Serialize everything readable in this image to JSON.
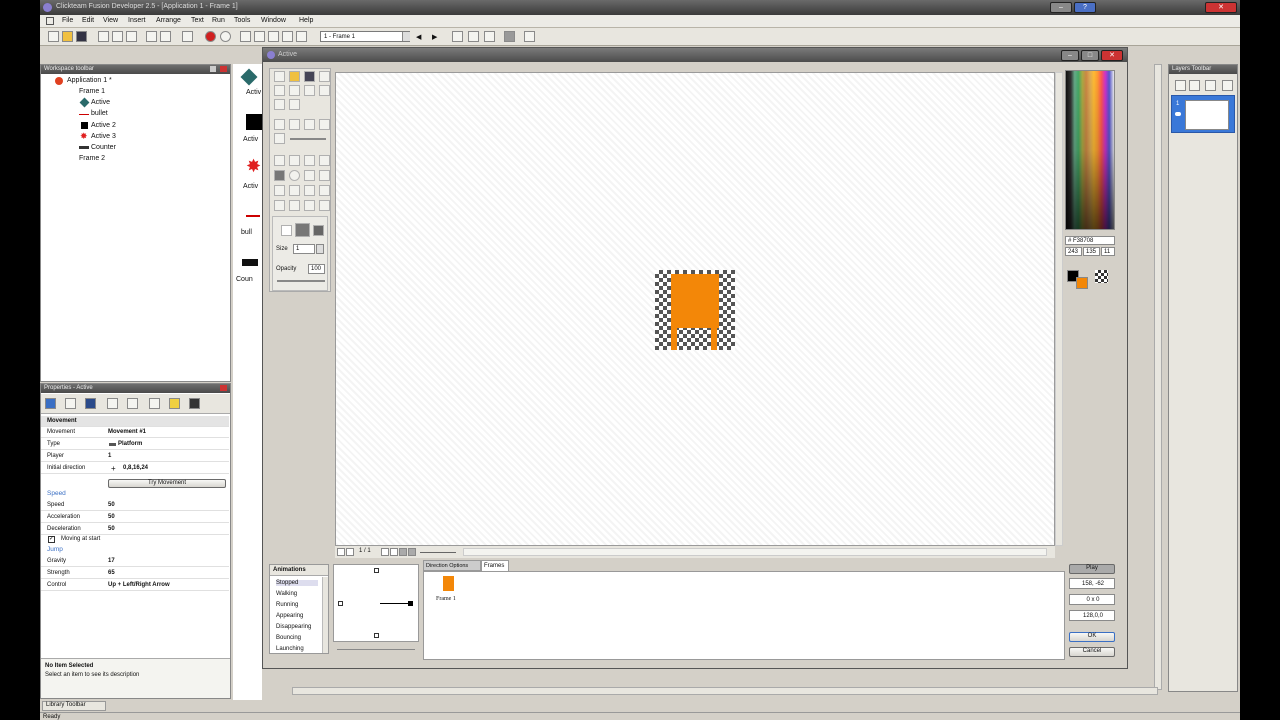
{
  "window": {
    "title": "Clickteam Fusion Developer 2.5 - [Application 1 - Frame 1]"
  },
  "menu": [
    "File",
    "Edit",
    "View",
    "Insert",
    "Arrange",
    "Text",
    "Run",
    "Tools",
    "Window",
    "Help"
  ],
  "toolbar": {
    "frame_select": "1 - Frame 1"
  },
  "workspace": {
    "title": "Workspace toolbar",
    "items": [
      "Application 1 *",
      "Frame 1",
      "Active",
      "bullet",
      "Active 2",
      "Active 3",
      "Counter",
      "Frame 2"
    ]
  },
  "frame_objects": [
    "Activ",
    "Activ",
    "Activ",
    "bull",
    "Coun"
  ],
  "properties": {
    "title": "Properties - Active",
    "header": "Movement",
    "rows": [
      {
        "k": "Movement",
        "v": "Movement #1"
      },
      {
        "k": "Type",
        "v": "Platform"
      },
      {
        "k": "Player",
        "v": "1"
      },
      {
        "k": "Initial direction",
        "v": "0,8,16,24"
      }
    ],
    "try_button": "Try Movement",
    "speed_section": "Speed",
    "speed_rows": [
      {
        "k": "Speed",
        "v": "50"
      },
      {
        "k": "Acceleration",
        "v": "50"
      },
      {
        "k": "Deceleration",
        "v": "50"
      }
    ],
    "moving_at_start": "Moving at start",
    "jump_section": "Jump",
    "jump_rows": [
      {
        "k": "Gravity",
        "v": "17"
      },
      {
        "k": "Strength",
        "v": "65"
      },
      {
        "k": "Control",
        "v": "Up + Left/Right Arrow"
      }
    ],
    "no_item": "No Item Selected",
    "no_item_desc": "Select an item to see its description"
  },
  "library": {
    "tab": "Library Toolbar",
    "status": "Ready"
  },
  "editor": {
    "title": "Active",
    "size_label": "Size",
    "size_value": "1",
    "opacity_label": "Opacity",
    "opacity_value": "100",
    "frame_counter": "1 / 1",
    "color_hex": "# F38708",
    "rgb": [
      "243",
      "135",
      "11"
    ],
    "animations_tab": "Animations",
    "animations": [
      "Stopped",
      "Walking",
      "Running",
      "Appearing",
      "Disappearing",
      "Bouncing",
      "Launching"
    ],
    "tabs": [
      "Direction Options",
      "Frames"
    ],
    "frame_label": "Frame 1",
    "fields": [
      "158, -62",
      "0 x 0",
      "128,0,0"
    ],
    "play_button": "Play",
    "ok_button": "OK",
    "cancel_button": "Cancel",
    "colors": {
      "accent": "#f38708"
    }
  },
  "layers": {
    "title": "Layers Toolbar",
    "item": "1"
  }
}
